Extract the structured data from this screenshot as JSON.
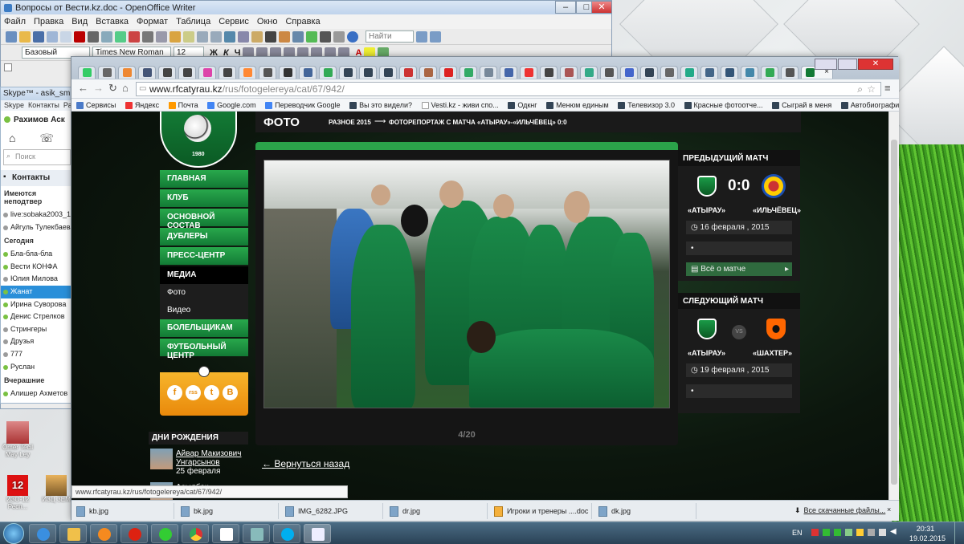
{
  "writer": {
    "title": "Вопросы от Вести.kz.doc - OpenOffice Writer",
    "menu": [
      "Файл",
      "Правка",
      "Вид",
      "Вставка",
      "Формат",
      "Таблица",
      "Сервис",
      "Окно",
      "Справка"
    ],
    "find_placeholder": "Найти",
    "style": "Базовый",
    "font": "Times New Roman",
    "size": "12",
    "format_buttons": [
      "Ж",
      "К",
      "Ч",
      "A"
    ]
  },
  "skype": {
    "title": "Skype™ - asik_smile",
    "menu": [
      "Skype",
      "Контакты",
      "Разг"
    ],
    "user": "Рахимов Аск",
    "search_placeholder": "Поиск",
    "contacts_tab": "Контакты",
    "pending": "Имеются неподтвер",
    "requests": [
      "live:sobaka2003_1",
      "Айгуль Тулекбаева"
    ],
    "today_label": "Сегодня",
    "today": [
      "Бла-бла-бла",
      "Вести КОНФА",
      "Юлия Милова",
      "Жанат",
      "Ирина Суворова",
      "Денис Стрелков",
      "Стрингеры",
      "Друзья",
      "777",
      "Руслан"
    ],
    "yesterday_label": "Вчерашние",
    "yesterday": [
      "Алишер Ахметов"
    ]
  },
  "browser": {
    "url_host": "www.rfcatyrau.kz",
    "url_path": "/rus/fotogelereya/cat/67/942/",
    "bookmarks": [
      "Сервисы",
      "Яндекс",
      "Почта",
      "Google.com",
      "Переводчик Google",
      "Вы это видели?",
      "Vesti.kz - живи спо...",
      "Одкнг",
      "Менюм единым",
      "Телевизор 3.0",
      "Красные фотоотче...",
      "Сыграй в меня",
      "Автобиографии кр..."
    ],
    "status_url": "www.rfcatyrau.kz/rus/fotogelereya/cat/67/942/",
    "downloads": [
      "kb.jpg",
      "bk.jpg",
      "IMG_6282.JPG",
      "dr.jpg",
      "Игроки и тренеры ....doc",
      "dk.jpg"
    ],
    "all_downloads": "Все скачанные файлы..."
  },
  "site": {
    "logo_year": "1980",
    "nav": [
      "ГЛАВНАЯ",
      "КЛУБ",
      "ОСНОВНОЙ СОСТАВ",
      "ДУБЛЕРЫ",
      "ПРЕСС-ЦЕНТР"
    ],
    "media_label": "МЕДИА",
    "media_sub": [
      "Фото",
      "Видео"
    ],
    "nav2": [
      "БОЛЕЛЬЩИКАМ",
      "ФУТБОЛЬНЫЙ ЦЕНТР"
    ],
    "social": [
      "f",
      "rss",
      "t",
      "B"
    ],
    "page_title": "ФОТО",
    "breadcrumb_1": "РАЗНОЕ 2015",
    "breadcrumb_arrow": "⟶",
    "breadcrumb_2": "ФОТОРЕПОРТАЖ С МАТЧА «АТЫРАУ»-«ИЛЬЧЁВЕЦ» 0:0",
    "counter": "4/20",
    "back_link": "← Вернуться назад",
    "birthdays_label": "ДНИ РОЖДЕНИЯ",
    "birthdays": [
      {
        "name": "Айвар Макизович Унгарсынов",
        "date": "25 февраля"
      },
      {
        "name": "Асылбек",
        "date": ""
      }
    ],
    "prev_match": {
      "label": "ПРЕДЫДУЩИЙ МАТЧ",
      "home": "«АТЫРАУ»",
      "away": "«ИЛЬЧЁВЕЦ»",
      "score": "0:0",
      "date": "16 февраля , 2015",
      "details": "Всё о матче"
    },
    "next_match": {
      "label": "СЛЕДУЮЩИЙ МАТЧ",
      "home": "«АТЫРАУ»",
      "away": "«ШАХТЕР»",
      "vs": "VS",
      "date": "19 февраля , 2015"
    }
  },
  "desktop_icons": [
    "Ömer Tecil May Ley",
    "ИЗО-12 Респ...",
    "ИЗЦ ЗЕМ"
  ],
  "taskbar": {
    "lang": "EN",
    "time": "20:31",
    "date": "19.02.2015"
  },
  "colors": {
    "brand_green": "#137a35",
    "accent_orange": "#f0a020",
    "taskbar": "#2a4256"
  }
}
